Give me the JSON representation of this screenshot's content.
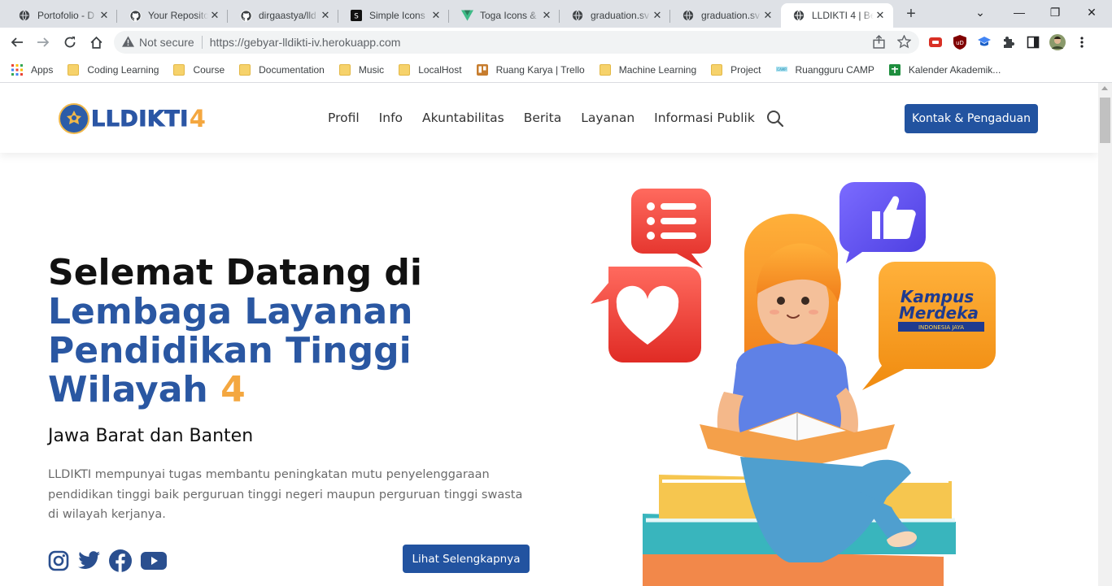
{
  "browser": {
    "tabs": [
      {
        "title": "Portofolio - D",
        "icon": "globe-icon"
      },
      {
        "title": "Your Reposito",
        "icon": "github-icon"
      },
      {
        "title": "dirgaastya/lld",
        "icon": "github-icon"
      },
      {
        "title": "Simple Icons",
        "icon": "simple-icons-icon"
      },
      {
        "title": "Toga Icons &",
        "icon": "toga-icon"
      },
      {
        "title": "graduation.sv",
        "icon": "globe-icon"
      },
      {
        "title": "graduation.sv",
        "icon": "globe-icon"
      },
      {
        "title": "LLDIKTI 4 | Be",
        "icon": "globe-icon",
        "active": true
      }
    ],
    "security": "Not secure",
    "url": "https://gebyar-lldikti-iv.herokuapp.com",
    "bookmarks": [
      {
        "label": "Apps",
        "icon": "apps-grid-icon"
      },
      {
        "label": "Coding Learning",
        "icon": "folder-icon"
      },
      {
        "label": "Course",
        "icon": "folder-icon"
      },
      {
        "label": "Documentation",
        "icon": "folder-icon"
      },
      {
        "label": "Music",
        "icon": "folder-icon"
      },
      {
        "label": "LocalHost",
        "icon": "folder-icon"
      },
      {
        "label": "Ruang Karya | Trello",
        "icon": "trello-icon"
      },
      {
        "label": "Machine Learning",
        "icon": "folder-icon"
      },
      {
        "label": "Project",
        "icon": "folder-icon"
      },
      {
        "label": "Ruangguru CAMP",
        "icon": "ruangguru-icon"
      },
      {
        "label": "Kalender Akademik...",
        "icon": "sheets-icon"
      }
    ]
  },
  "site": {
    "logo_text": "LLDIKTI",
    "logo_number": "4",
    "nav": [
      "Profil",
      "Info",
      "Akuntabilitas",
      "Berita",
      "Layanan",
      "Informasi Publik"
    ],
    "cta": "Kontak & Pengaduan"
  },
  "hero": {
    "title_line1": "Selemat Datang di",
    "title_line2": "Lembaga Layanan",
    "title_line3": "Pendidikan Tinggi",
    "title_line4": "Wilayah",
    "title_number": "4",
    "subtitle": "Jawa Barat dan Banten",
    "description": "LLDIKTI mempunyai tugas membantu peningkatan mutu penyelenggaraan pendidikan tinggi baik perguruan tinggi negeri maupun perguruan tinggi swasta di wilayah kerjanya.",
    "socials": [
      "instagram-icon",
      "twitter-icon",
      "facebook-icon",
      "youtube-icon"
    ],
    "more_button": "Lihat Selengkapnya"
  },
  "illustration": {
    "badge_line1": "Kampus",
    "badge_line2": "Merdeka",
    "badge_line3": "INDONESIA JAYA"
  },
  "colors": {
    "brand_blue": "#2253a0",
    "accent_orange": "#f4a740",
    "tabstrip": "#dee1e6"
  }
}
